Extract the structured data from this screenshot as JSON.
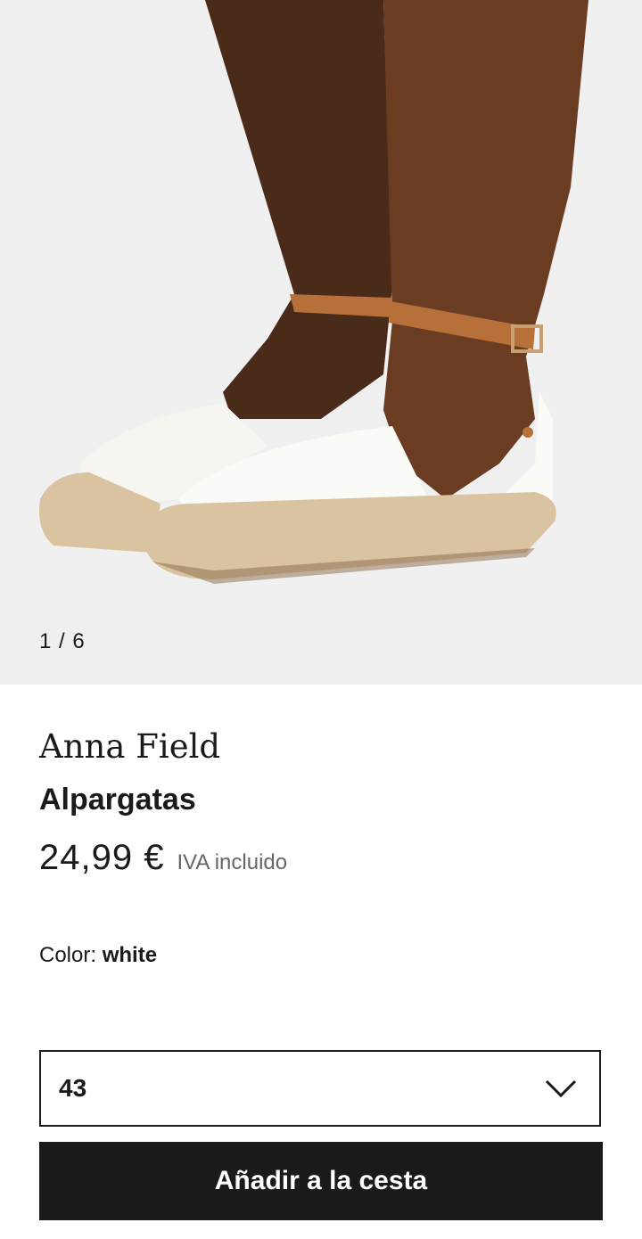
{
  "gallery": {
    "counter": "1 / 6",
    "current": 1,
    "total": 6
  },
  "product": {
    "brand": "Anna Field",
    "name": "Alpargatas",
    "price": "24,99 €",
    "tax_note": "IVA incluido",
    "color_label": "Color:",
    "color_value": "white"
  },
  "size_select": {
    "value": "43",
    "icon": "chevron-down-icon"
  },
  "cta": {
    "label": "Añadir a la cesta"
  },
  "colors": {
    "background": "#f0f0f0",
    "button": "#1a1a1a",
    "button_text": "#ffffff",
    "strap": "#b8703a",
    "skin": "#5a3420",
    "jute": "#d9c3a0"
  }
}
